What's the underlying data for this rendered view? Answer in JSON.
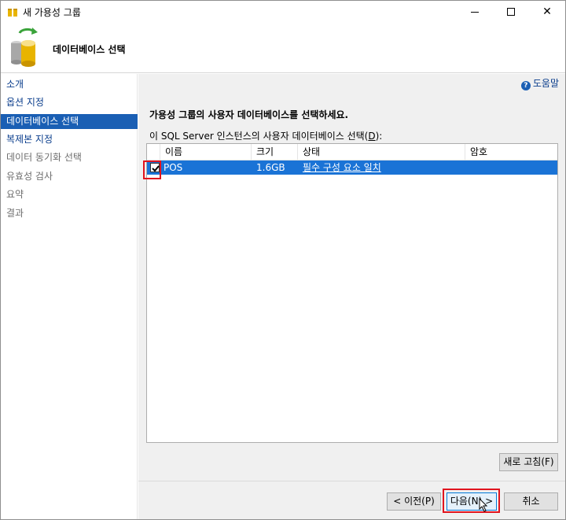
{
  "window": {
    "title": "새 가용성 그룹",
    "minimize_icon": "minimize-icon",
    "maximize_icon": "maximize-icon",
    "close_glyph": "✕"
  },
  "header": {
    "page_title": "데이터베이스 선택",
    "icon": "database-icon"
  },
  "nav": {
    "items": [
      {
        "label": "소개",
        "state": "link"
      },
      {
        "label": "옵션 지정",
        "state": "link"
      },
      {
        "label": "데이터베이스 선택",
        "state": "active"
      },
      {
        "label": "복제본 지정",
        "state": "link"
      },
      {
        "label": "데이터 동기화 선택",
        "state": "disabled"
      },
      {
        "label": "유효성 검사",
        "state": "disabled"
      },
      {
        "label": "요약",
        "state": "disabled"
      },
      {
        "label": "결과",
        "state": "disabled"
      }
    ]
  },
  "help": {
    "label": "도움말",
    "icon": "help-icon"
  },
  "main": {
    "instruction": "가용성 그룹의 사용자 데이터베이스를 선택하세요.",
    "grid_label_prefix": "이 SQL Server 인스턴스의 사용자 데이터베이스 선택(",
    "grid_label_key": "D",
    "grid_label_suffix": "):",
    "columns": [
      "이름",
      "크기",
      "상태",
      "암호"
    ],
    "rows": [
      {
        "checked": true,
        "name": "POS",
        "size": "1.6GB",
        "status": "필수 구성 요소 일치",
        "password": ""
      }
    ]
  },
  "buttons": {
    "refresh": "새로 고침(F)",
    "prev": "< 이전(P)",
    "next": "다음(N) >",
    "cancel": "취소"
  },
  "colors": {
    "selection": "#1a73d6",
    "nav_active": "#1a5fb4",
    "highlight_box": "#e0141e"
  }
}
